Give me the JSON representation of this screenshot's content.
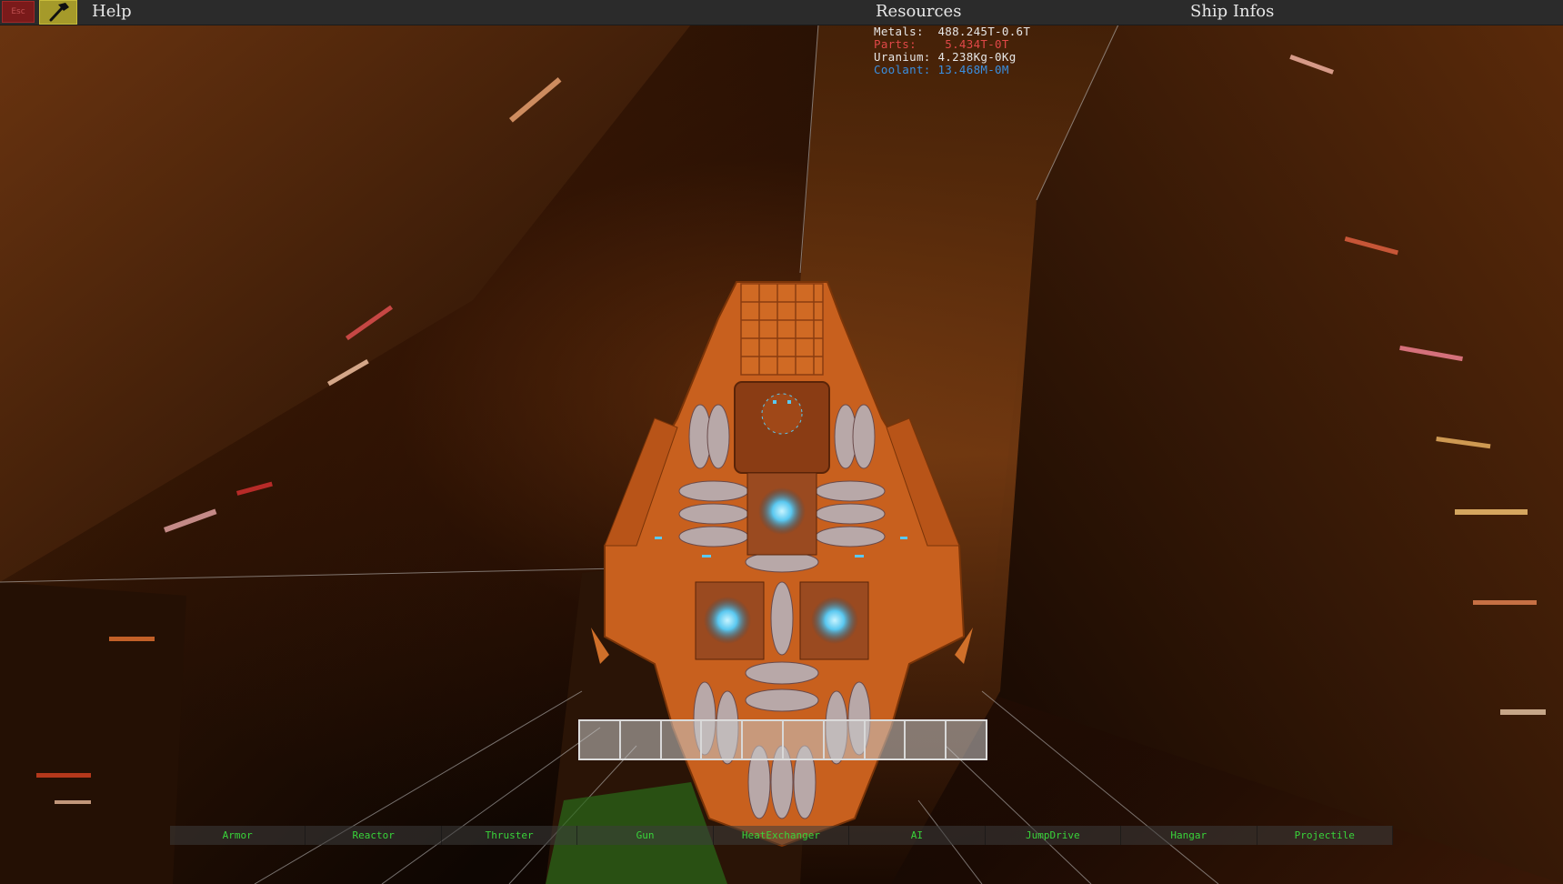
{
  "topbar": {
    "stop_label": "Esc",
    "help_label": "Help",
    "resources_label": "Resources",
    "ship_infos_label": "Ship Infos"
  },
  "resources": [
    {
      "label": "Metals:",
      "value": "488.245T-0.6T",
      "color": "#e6e6e6"
    },
    {
      "label": "Parts:",
      "value": "5.434T-0T",
      "color": "#e04848"
    },
    {
      "label": "Uranium:",
      "value": "4.238Kg-0Kg",
      "color": "#e6e6e6"
    },
    {
      "label": "Coolant:",
      "value": "13.468M-0M",
      "color": "#3a8fe0"
    }
  ],
  "hotbar": {
    "slot_count": 10
  },
  "categories": [
    {
      "label": "Armor"
    },
    {
      "label": "Reactor"
    },
    {
      "label": "Thruster"
    },
    {
      "label": "Gun"
    },
    {
      "label": "HeatExchanger"
    },
    {
      "label": "AI"
    },
    {
      "label": "JumpDrive"
    },
    {
      "label": "Hangar"
    },
    {
      "label": "Projectile"
    }
  ],
  "colors": {
    "accent_green": "#39d43a",
    "hull_orange": "#c8601e",
    "glow_blue": "#5ac8f0"
  }
}
